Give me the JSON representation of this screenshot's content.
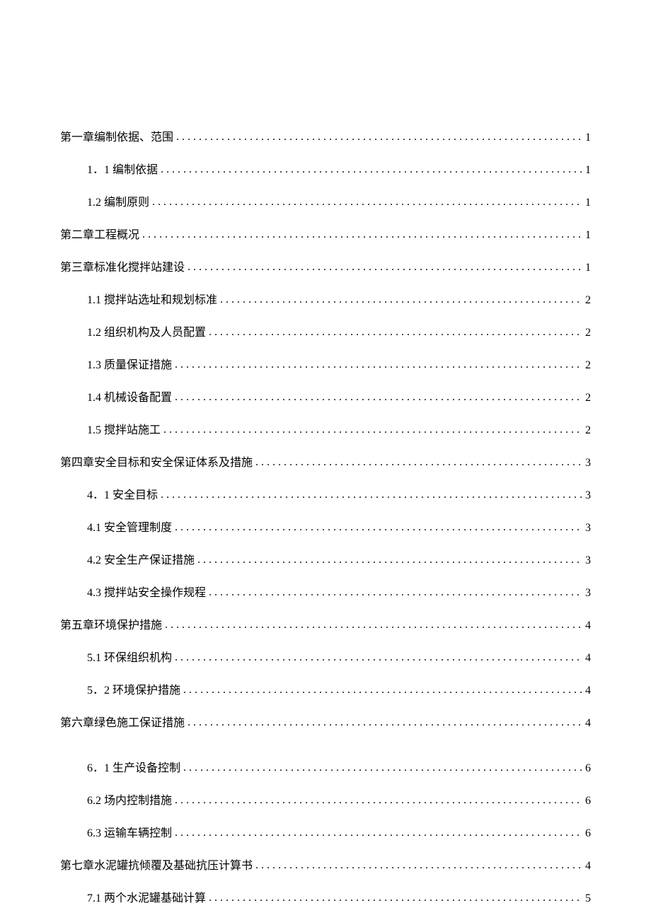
{
  "toc": [
    {
      "level": 0,
      "label": "第一章编制依据、范围",
      "page": "1"
    },
    {
      "level": 1,
      "label": "1．1 编制依据",
      "page": "1"
    },
    {
      "level": 1,
      "label": "1.2 编制原则",
      "page": "1"
    },
    {
      "level": 0,
      "label": "第二章工程概况",
      "page": "1"
    },
    {
      "level": 0,
      "label": "第三章标准化搅拌站建设",
      "page": "1"
    },
    {
      "level": 1,
      "label": "1.1  搅拌站选址和规划标准",
      "page": "2"
    },
    {
      "level": 1,
      "label": "1.2  组织机构及人员配置",
      "page": "2"
    },
    {
      "level": 1,
      "label": "1.3  质量保证措施",
      "page": "2"
    },
    {
      "level": 1,
      "label": "1.4  机械设备配置",
      "page": "2"
    },
    {
      "level": 1,
      "label": "1.5  搅拌站施工",
      "page": "2"
    },
    {
      "level": 0,
      "label": "第四章安全目标和安全保证体系及措施",
      "page": "3"
    },
    {
      "level": 1,
      "label": "4．1 安全目标",
      "page": "3"
    },
    {
      "level": 1,
      "label": "4.1  安全管理制度",
      "page": "3"
    },
    {
      "level": 1,
      "label": "4.2  安全生产保证措施",
      "page": "3"
    },
    {
      "level": 1,
      "label": "4.3  搅拌站安全操作规程",
      "page": "3"
    },
    {
      "level": 0,
      "label": "第五章环境保护措施",
      "page": "4"
    },
    {
      "level": 1,
      "label": "5.1 环保组织机构",
      "page": "4"
    },
    {
      "level": 1,
      "label": "5．2 环境保护措施",
      "page": "4"
    },
    {
      "level": 0,
      "label": "第六章绿色施工保证措施",
      "page": "4",
      "flushLeft": true
    },
    {
      "level": 1,
      "label": "6．1 生产设备控制",
      "page": "6",
      "extraTop": true
    },
    {
      "level": 1,
      "label": "6.2  场内控制措施",
      "page": "6"
    },
    {
      "level": 1,
      "label": "6.3  运输车辆控制",
      "page": "6"
    },
    {
      "level": 0,
      "label": "第七章水泥罐抗倾覆及基础抗压计算书",
      "page": "4"
    },
    {
      "level": 1,
      "label": "7.1  两个水泥罐基础计算",
      "page": "5"
    }
  ]
}
